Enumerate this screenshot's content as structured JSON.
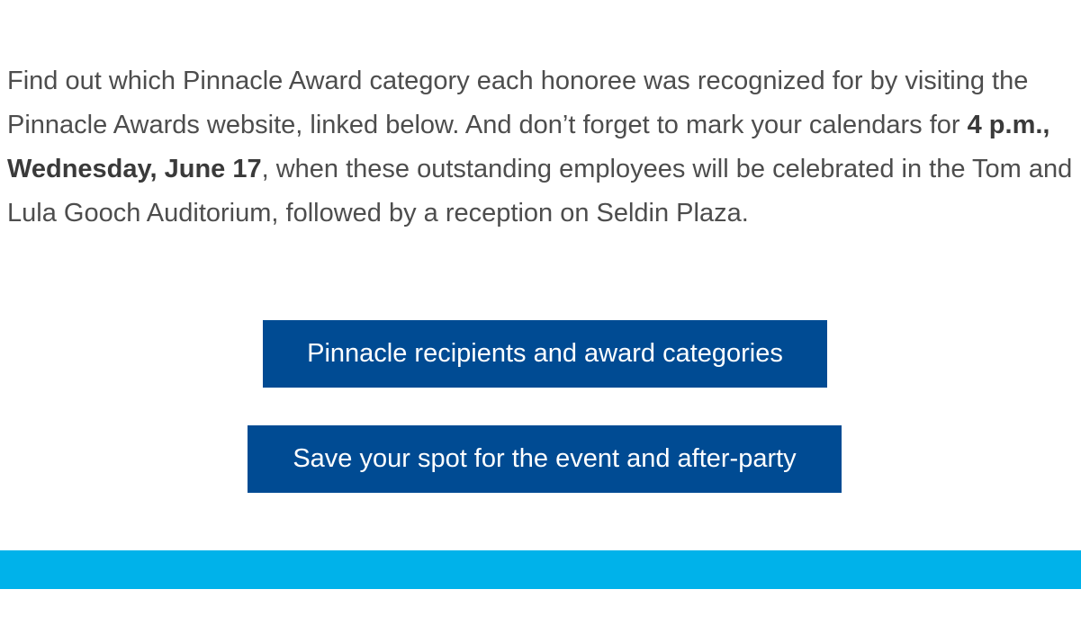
{
  "body_text": {
    "part1": "Find out which Pinnacle Award category each honoree was recognized for by visiting the Pinnacle Awards website, linked below. And don’t forget to mark your calendars for ",
    "bold": "4 p.m., Wednesday, June 17",
    "part2": ", when these outstanding employees will be celebrated in the Tom and Lula Gooch Auditorium, followed by a reception on Seldin Plaza."
  },
  "buttons": {
    "recipients_label": "Pinnacle recipients and award categories",
    "save_spot_label": "Save your spot for the event and after-party"
  },
  "colors": {
    "button_bg": "#004b93",
    "footer_bar": "#00b2ea",
    "text": "#4d4d4d"
  }
}
